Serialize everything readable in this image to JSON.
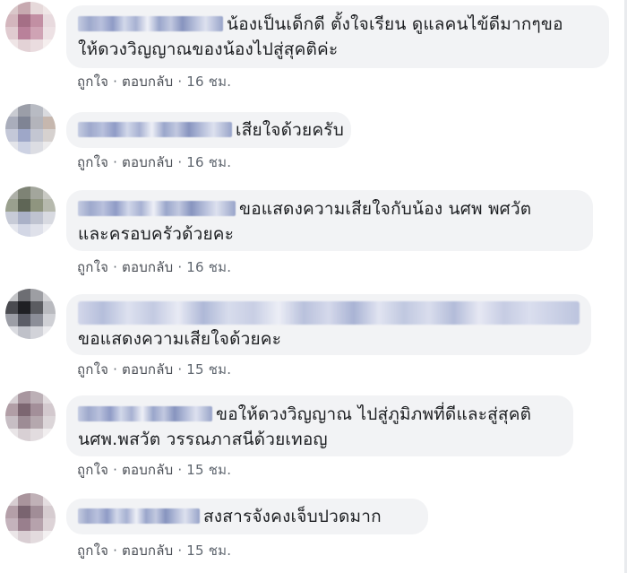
{
  "actions": {
    "like": "ถูกใจ",
    "reply": "ตอบกลับ",
    "separator": "·"
  },
  "comments": [
    {
      "text_line1": "น้องเป็นเด็กดี ตั้งใจเรียน ดูแลคนไข้ดีมากๆขอ",
      "text_line2": "ให้ดวงวิญญาณของน้องไปสู่สุคติค่ะ",
      "time": "16 ชม."
    },
    {
      "text_line1": "เสียใจด้วยครับ",
      "time": "16 ชม."
    },
    {
      "text_line1": "ขอแสดงความเสียใจกับน้อง นศพ พศวัต",
      "text_line2": "และครอบครัวด้วยคะ",
      "time": "16 ชม."
    },
    {
      "text_line1": "ขอแสดงความเสียใจด้วยคะ",
      "time": "15 ชม."
    },
    {
      "text_line1": "ขอให้ดวงวิญญาณ ไปสู่ภูมิภพที่ดีและสู่สุคติ",
      "text_line2": "นศพ.พสวัต วรรณภาสนีด้วยเทอญ",
      "time": "15 ชม."
    },
    {
      "text_line1": "สงสารจังคงเจ็บปวดมาก",
      "time": "15 ชม."
    }
  ]
}
